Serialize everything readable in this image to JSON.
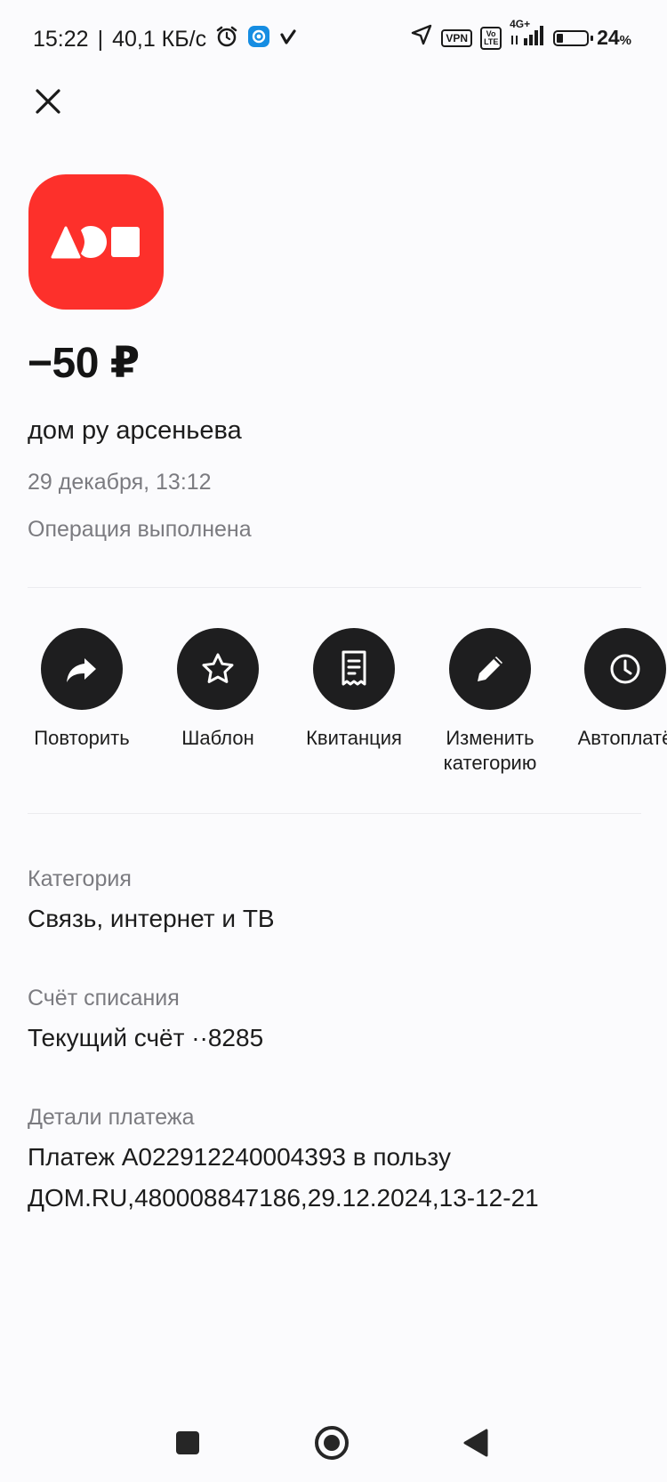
{
  "status_bar": {
    "time": "15:22",
    "separator": "|",
    "speed": "40,1 КБ/с",
    "vpn_label": "VPN",
    "volte_label": "Vo LTE",
    "network_label": "4G+",
    "battery_value": "24",
    "battery_unit": "%"
  },
  "transaction": {
    "amount": "−50 ₽",
    "merchant": "дом ру арсеньева",
    "date": "29 декабря, 13:12",
    "status": "Операция выполнена",
    "logo_color": "#fd302b"
  },
  "actions": [
    {
      "label": "Повторить",
      "icon": "share-arrow-icon"
    },
    {
      "label": "Шаблон",
      "icon": "star-icon"
    },
    {
      "label": "Квитанция",
      "icon": "receipt-icon"
    },
    {
      "label": "Изменить\nкатегорию",
      "icon": "pencil-icon"
    },
    {
      "label": "Автоплатё",
      "icon": "clock-icon"
    }
  ],
  "details": {
    "category_label": "Категория",
    "category_value": "Связь, интернет и ТВ",
    "account_label": "Счёт списания",
    "account_value": "Текущий счёт ··8285",
    "payment_label": "Детали платежа",
    "payment_value_line1": "Платеж A022912240004393 в пользу",
    "payment_value_line2": "ДОМ.RU,480008847186,29.12.2024,13-12-21"
  }
}
